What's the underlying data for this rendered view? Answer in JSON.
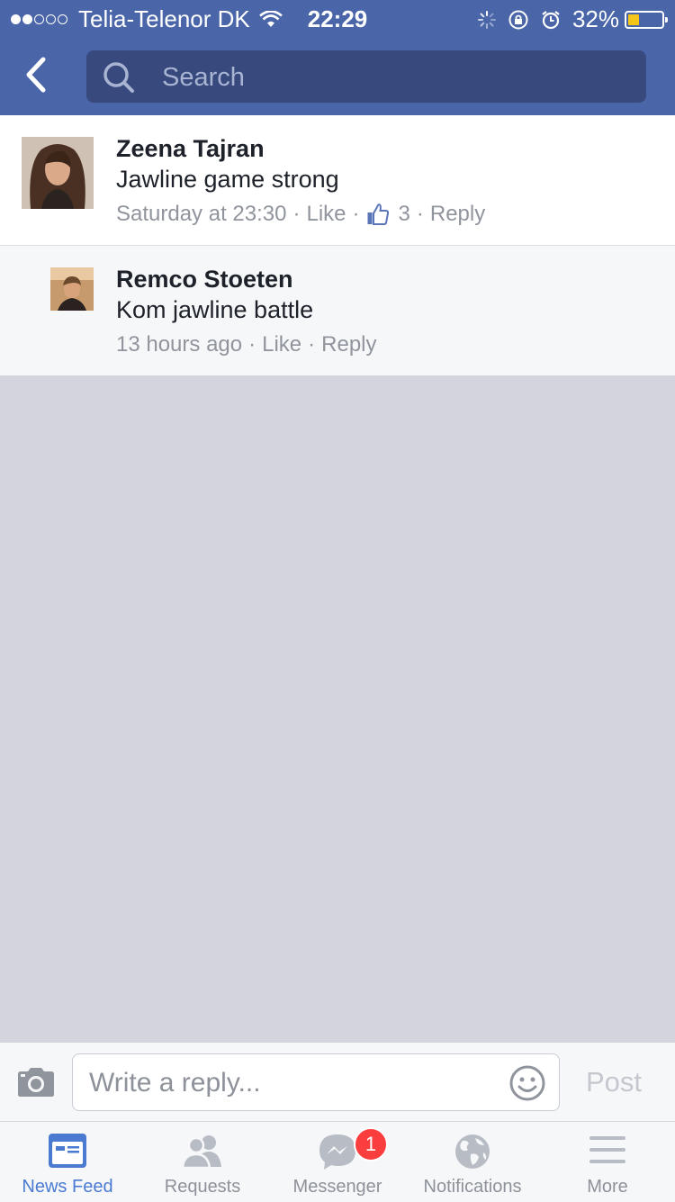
{
  "status_bar": {
    "carrier": "Telia-Telenor DK",
    "time": "22:29",
    "battery": "32%",
    "battery_level": 0.32
  },
  "header": {
    "back_icon": "chevron-left-icon",
    "search": {
      "placeholder": "Search"
    }
  },
  "comments": [
    {
      "author": "Zeena Tajran",
      "text": "Jawline game strong",
      "time": "Saturday at 23:30",
      "like_label": "Like",
      "like_count": "3",
      "reply_label": "Reply"
    },
    {
      "author": "Remco Stoeten",
      "text": "Kom jawline battle",
      "time": "13 hours ago",
      "like_label": "Like",
      "reply_label": "Reply"
    }
  ],
  "composer": {
    "placeholder": "Write a reply...",
    "post_label": "Post"
  },
  "tabs": [
    {
      "label": "News Feed",
      "icon": "news-feed-icon",
      "active": true
    },
    {
      "label": "Requests",
      "icon": "friends-icon"
    },
    {
      "label": "Messenger",
      "icon": "messenger-icon",
      "badge": "1"
    },
    {
      "label": "Notifications",
      "icon": "globe-icon"
    },
    {
      "label": "More",
      "icon": "menu-icon"
    }
  ],
  "colors": {
    "header_bg": "#4a66a9",
    "search_bg": "#37497d",
    "active_tab": "#4a7bd1",
    "badge": "#fa3e3e",
    "battery_fill": "#f5c518"
  }
}
